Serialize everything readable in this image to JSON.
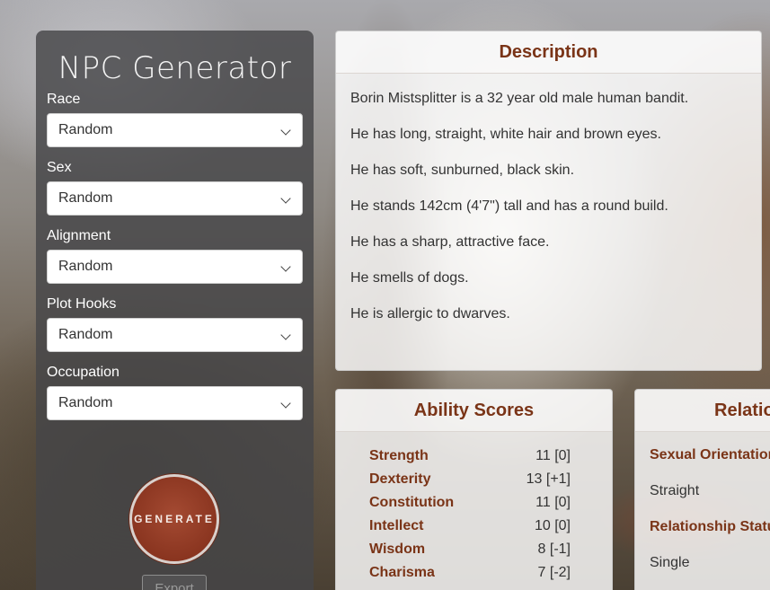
{
  "app": {
    "title": "NPC Generator"
  },
  "filters": [
    {
      "label": "Race",
      "value": "Random"
    },
    {
      "label": "Sex",
      "value": "Random"
    },
    {
      "label": "Alignment",
      "value": "Random"
    },
    {
      "label": "Plot Hooks",
      "value": "Random"
    },
    {
      "label": "Occupation",
      "value": "Random"
    }
  ],
  "actions": {
    "generate_label": "GENERATE",
    "export_label": "Export"
  },
  "description": {
    "title": "Description",
    "lines": [
      "Borin Mistsplitter is a 32 year old male human bandit.",
      "He has long, straight, white hair and brown eyes.",
      "He has soft, sunburned, black skin.",
      "He stands 142cm (4'7\") tall and has a round build.",
      "He has a sharp, attractive face.",
      "He smells of dogs.",
      "He is allergic to dwarves."
    ]
  },
  "abilities": {
    "title": "Ability Scores",
    "rows": [
      {
        "name": "Strength",
        "value": "11 [0]"
      },
      {
        "name": "Dexterity",
        "value": "13 [+1]"
      },
      {
        "name": "Constitution",
        "value": "11 [0]"
      },
      {
        "name": "Intellect",
        "value": "10 [0]"
      },
      {
        "name": "Wisdom",
        "value": "8 [-1]"
      },
      {
        "name": "Charisma",
        "value": "7 [-2]"
      }
    ]
  },
  "relationships": {
    "title": "Relationships",
    "items": [
      {
        "label": "Sexual Orientation",
        "value": "Straight"
      },
      {
        "label": "Relationship Status",
        "value": "Single"
      }
    ]
  },
  "colors": {
    "accent": "#7a3417",
    "button": "#8a3520"
  },
  "icons": {
    "select_arrow": "chevron-down-icon"
  }
}
